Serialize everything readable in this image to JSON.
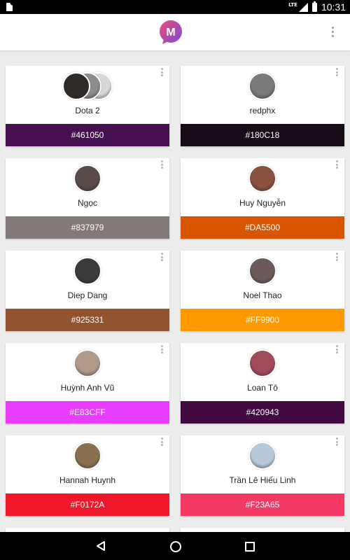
{
  "status_bar": {
    "network": "LTE",
    "time": "10:31"
  },
  "app_bar": {
    "logo_letter": "M",
    "logo_gradient": [
      "#F04A7A",
      "#7A4BD6"
    ]
  },
  "cards": [
    {
      "name": "Dota 2",
      "hex": "#461050",
      "color": "#461050",
      "avatars": [
        "#2f2a28",
        "#8c8c8c",
        "#d8d8d8"
      ]
    },
    {
      "name": "redphx",
      "hex": "#180C18",
      "color": "#180C18",
      "avatars": [
        "#7a7a7a"
      ]
    },
    {
      "name": "Ngọc",
      "hex": "#837979",
      "color": "#837979",
      "avatars": [
        "#5a4a48"
      ]
    },
    {
      "name": "Huy Nguyễn",
      "hex": "#DA5500",
      "color": "#DA5500",
      "avatars": [
        "#8a5040"
      ]
    },
    {
      "name": "Diep Dang",
      "hex": "#925331",
      "color": "#925331",
      "avatars": [
        "#3c3a38"
      ]
    },
    {
      "name": "Noel Thao",
      "hex": "#FF9900",
      "color": "#FF9900",
      "avatars": [
        "#6c5a5a"
      ]
    },
    {
      "name": "Huỳnh Anh Vũ",
      "hex": "#E83CFF",
      "color": "#E83CFF",
      "avatars": [
        "#b29a8a"
      ]
    },
    {
      "name": "Loan Tô",
      "hex": "#420943",
      "color": "#420943",
      "avatars": [
        "#a04a5a"
      ]
    },
    {
      "name": "Hannah Huynh",
      "hex": "#F0172A",
      "color": "#F0172A",
      "avatars": [
        "#8a7050"
      ]
    },
    {
      "name": "Trần Lê Hiếu Linh",
      "hex": "#F23A65",
      "color": "#F23A65",
      "avatars": [
        "#b7c9d8"
      ]
    }
  ]
}
